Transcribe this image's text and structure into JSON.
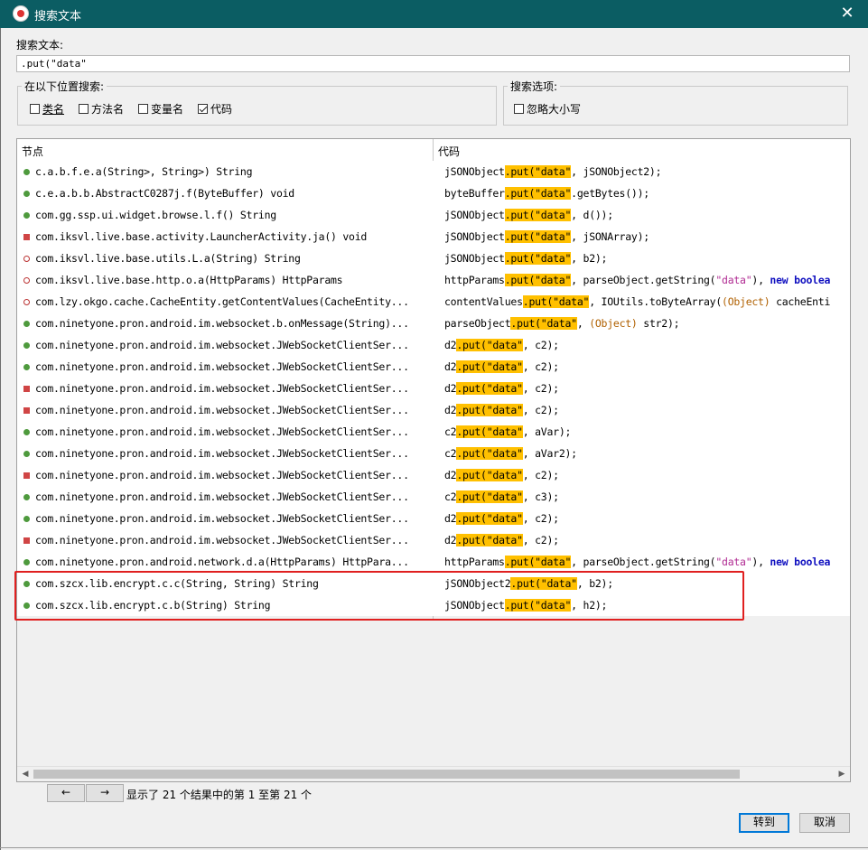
{
  "window": {
    "title": "搜索文本",
    "close_glyph": "✕"
  },
  "search": {
    "label": "搜索文本:",
    "value": ".put(\"data\""
  },
  "location_group": {
    "legend": "在以下位置搜索:",
    "options": [
      {
        "label": "类名",
        "checked": false
      },
      {
        "label": "方法名",
        "checked": false
      },
      {
        "label": "变量名",
        "checked": false
      },
      {
        "label": "代码",
        "checked": true
      }
    ]
  },
  "options_group": {
    "legend": "搜索选项:",
    "ignore_case": {
      "label": "忽略大小写",
      "checked": false
    }
  },
  "table": {
    "columns": [
      "节点",
      "代码"
    ],
    "rows": [
      {
        "icon": "green",
        "node": "c.a.b.f.e.a(String>, String>) String",
        "code": [
          [
            "jSONObject",
            ""
          ],
          [
            ".put(\"data\"",
            "hl"
          ],
          [
            ", jSONObject2);",
            ""
          ]
        ]
      },
      {
        "icon": "green",
        "node": "c.e.a.b.b.AbstractC0287j.f(ByteBuffer) void",
        "code": [
          [
            "byteBuffer",
            ""
          ],
          [
            ".put(\"data\"",
            "hl"
          ],
          [
            ".getBytes());",
            ""
          ]
        ]
      },
      {
        "icon": "green",
        "node": "com.gg.ssp.ui.widget.browse.l.f() String",
        "code": [
          [
            "jSONObject",
            ""
          ],
          [
            ".put(\"data\"",
            "hl"
          ],
          [
            ", d());",
            ""
          ]
        ]
      },
      {
        "icon": "red",
        "node": "com.iksvl.live.base.activity.LauncherActivity.ja() void",
        "code": [
          [
            "jSONObject",
            ""
          ],
          [
            ".put(\"data\"",
            "hl"
          ],
          [
            ", jSONArray);",
            ""
          ]
        ]
      },
      {
        "icon": "lock",
        "node": "com.iksvl.live.base.utils.L.a(String) String",
        "code": [
          [
            "jSONObject",
            ""
          ],
          [
            ".put(\"data\"",
            "hl"
          ],
          [
            ", b2);",
            ""
          ]
        ]
      },
      {
        "icon": "lock",
        "node": "com.iksvl.live.base.http.o.a(HttpParams) HttpParams",
        "code": [
          [
            "httpParams",
            ""
          ],
          [
            ".put(\"data\"",
            "hl"
          ],
          [
            ", parseObject.getString(",
            ""
          ],
          [
            "\"data\"",
            "str"
          ],
          [
            "), ",
            ""
          ],
          [
            "new",
            "kw"
          ],
          [
            " ",
            ""
          ],
          [
            "boolea",
            "kw"
          ]
        ]
      },
      {
        "icon": "lock",
        "node": "com.lzy.okgo.cache.CacheEntity.getContentValues(CacheEntity...",
        "code": [
          [
            "contentValues",
            ""
          ],
          [
            ".put(\"data\"",
            "hl"
          ],
          [
            ", IOUtils.toByteArray(",
            ""
          ],
          [
            "(Object)",
            "cast"
          ],
          [
            " cacheEnti",
            ""
          ]
        ]
      },
      {
        "icon": "green",
        "node": "com.ninetyone.pron.android.im.websocket.b.onMessage(String)...",
        "code": [
          [
            "parseObject",
            ""
          ],
          [
            ".put(\"data\"",
            "hl"
          ],
          [
            ", ",
            ""
          ],
          [
            "(Object)",
            "cast"
          ],
          [
            " str2);",
            ""
          ]
        ]
      },
      {
        "icon": "green",
        "node": "com.ninetyone.pron.android.im.websocket.JWebSocketClientSer...",
        "code": [
          [
            "d2",
            ""
          ],
          [
            ".put(\"data\"",
            "hl"
          ],
          [
            ", c2);",
            ""
          ]
        ]
      },
      {
        "icon": "green",
        "node": "com.ninetyone.pron.android.im.websocket.JWebSocketClientSer...",
        "code": [
          [
            "d2",
            ""
          ],
          [
            ".put(\"data\"",
            "hl"
          ],
          [
            ", c2);",
            ""
          ]
        ]
      },
      {
        "icon": "red",
        "node": "com.ninetyone.pron.android.im.websocket.JWebSocketClientSer...",
        "code": [
          [
            "d2",
            ""
          ],
          [
            ".put(\"data\"",
            "hl"
          ],
          [
            ", c2);",
            ""
          ]
        ]
      },
      {
        "icon": "red",
        "node": "com.ninetyone.pron.android.im.websocket.JWebSocketClientSer...",
        "code": [
          [
            "d2",
            ""
          ],
          [
            ".put(\"data\"",
            "hl"
          ],
          [
            ", c2);",
            ""
          ]
        ]
      },
      {
        "icon": "green",
        "node": "com.ninetyone.pron.android.im.websocket.JWebSocketClientSer...",
        "code": [
          [
            "c2",
            ""
          ],
          [
            ".put(\"data\"",
            "hl"
          ],
          [
            ", aVar);",
            ""
          ]
        ]
      },
      {
        "icon": "green",
        "node": "com.ninetyone.pron.android.im.websocket.JWebSocketClientSer...",
        "code": [
          [
            "c2",
            ""
          ],
          [
            ".put(\"data\"",
            "hl"
          ],
          [
            ", aVar2);",
            ""
          ]
        ]
      },
      {
        "icon": "red",
        "node": "com.ninetyone.pron.android.im.websocket.JWebSocketClientSer...",
        "code": [
          [
            "d2",
            ""
          ],
          [
            ".put(\"data\"",
            "hl"
          ],
          [
            ", c2);",
            ""
          ]
        ]
      },
      {
        "icon": "green",
        "node": "com.ninetyone.pron.android.im.websocket.JWebSocketClientSer...",
        "code": [
          [
            "c2",
            ""
          ],
          [
            ".put(\"data\"",
            "hl"
          ],
          [
            ", c3);",
            ""
          ]
        ]
      },
      {
        "icon": "green",
        "node": "com.ninetyone.pron.android.im.websocket.JWebSocketClientSer...",
        "code": [
          [
            "d2",
            ""
          ],
          [
            ".put(\"data\"",
            "hl"
          ],
          [
            ", c2);",
            ""
          ]
        ]
      },
      {
        "icon": "red",
        "node": "com.ninetyone.pron.android.im.websocket.JWebSocketClientSer...",
        "code": [
          [
            "d2",
            ""
          ],
          [
            ".put(\"data\"",
            "hl"
          ],
          [
            ", c2);",
            ""
          ]
        ]
      },
      {
        "icon": "green",
        "node": "com.ninetyone.pron.android.network.d.a(HttpParams) HttpPara...",
        "code": [
          [
            "httpParams",
            ""
          ],
          [
            ".put(\"data\"",
            "hl"
          ],
          [
            ", parseObject.getString(",
            ""
          ],
          [
            "\"data\"",
            "str"
          ],
          [
            "), ",
            ""
          ],
          [
            "new",
            "kw"
          ],
          [
            " ",
            ""
          ],
          [
            "boolea",
            "kw"
          ]
        ]
      },
      {
        "icon": "green",
        "node": "com.szcx.lib.encrypt.c.c(String, String) String",
        "code": [
          [
            "jSONObject2",
            ""
          ],
          [
            ".put(\"data\"",
            "hl"
          ],
          [
            ", b2);",
            ""
          ]
        ]
      },
      {
        "icon": "green",
        "node": "com.szcx.lib.encrypt.c.b(String) String",
        "code": [
          [
            "jSONObject",
            ""
          ],
          [
            ".put(\"data\"",
            "hl"
          ],
          [
            ", h2);",
            ""
          ]
        ]
      }
    ]
  },
  "pager": {
    "prev": "←",
    "next": "→",
    "status": "显示了 21 个结果中的第 1 至第 21 个"
  },
  "buttons": {
    "goto": "转到",
    "cancel": "取消"
  }
}
